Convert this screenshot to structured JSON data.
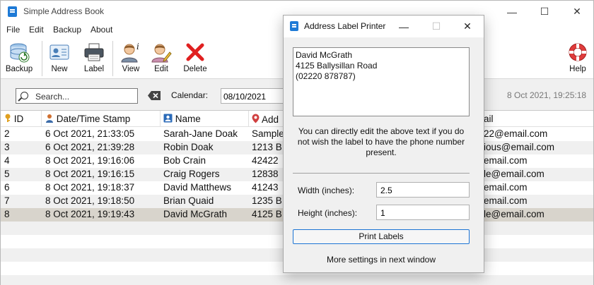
{
  "window": {
    "title": "Simple Address Book",
    "controls": {
      "minimize": "—",
      "maximize": "☐",
      "close": "✕"
    }
  },
  "menu": [
    "File",
    "Edit",
    "Backup",
    "About"
  ],
  "toolbar": {
    "backup": "Backup",
    "new": "New",
    "label": "Label",
    "view": "View",
    "edit": "Edit",
    "delete": "Delete",
    "help": "Help"
  },
  "filter": {
    "search_placeholder": "Search...",
    "calendar_label": "Calendar:",
    "calendar_value": "08/10/2021",
    "timestamp": "8 Oct 2021, 19:25:18"
  },
  "grid": {
    "columns": [
      "ID",
      "Date/Time Stamp",
      "Name",
      "Add",
      "ail"
    ],
    "rows": [
      {
        "id": "2",
        "date": "6 Oct 2021, 21:33:05",
        "name": "Sarah-Jane Doak",
        "address": "Sample",
        "email": "22@email.com",
        "selected": false
      },
      {
        "id": "3",
        "date": "6 Oct 2021, 21:39:28",
        "name": "Robin Doak",
        "address": "1213 B",
        "email": "ious@email.com",
        "selected": false
      },
      {
        "id": "4",
        "date": "8 Oct 2021, 19:16:06",
        "name": "Bob Crain",
        "address": "42422",
        "email": "email.com",
        "selected": false
      },
      {
        "id": "5",
        "date": "8 Oct 2021, 19:16:15",
        "name": "Craig Rogers",
        "address": "12838",
        "email": "le@email.com",
        "selected": false
      },
      {
        "id": "6",
        "date": "8 Oct 2021, 19:18:37",
        "name": "David Matthews",
        "address": "41243",
        "email": "email.com",
        "selected": false
      },
      {
        "id": "7",
        "date": "8 Oct 2021, 19:18:50",
        "name": "Brian Quaid",
        "address": "1235 B",
        "email": "email.com",
        "selected": false
      },
      {
        "id": "8",
        "date": "8 Oct 2021, 19:19:43",
        "name": "David McGrath",
        "address": "4125 B",
        "email": "le@email.com",
        "selected": true
      }
    ]
  },
  "dialog": {
    "title": "Address Label Printer",
    "label_text": "David McGrath\n4125 Ballysillan Road\n(02220 878787)",
    "hint": "You can directly edit the above text if you do not wish the label to have the phone number present.",
    "width_label": "Width (inches):",
    "width_value": "2.5",
    "height_label": "Height (inches):",
    "height_value": "1",
    "print_button": "Print Labels",
    "more_settings": "More settings in next window"
  },
  "colors": {
    "accent": "#1c74d4",
    "selected_row": "#d8d4cc",
    "delete_red": "#e02020"
  }
}
